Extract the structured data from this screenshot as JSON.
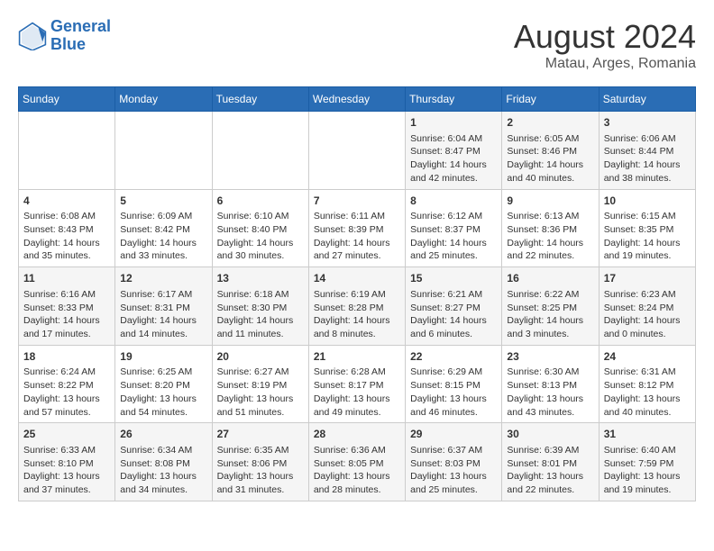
{
  "header": {
    "logo_line1": "General",
    "logo_line2": "Blue",
    "month_year": "August 2024",
    "location": "Matau, Arges, Romania"
  },
  "days_of_week": [
    "Sunday",
    "Monday",
    "Tuesday",
    "Wednesday",
    "Thursday",
    "Friday",
    "Saturday"
  ],
  "weeks": [
    [
      {
        "day": "",
        "content": ""
      },
      {
        "day": "",
        "content": ""
      },
      {
        "day": "",
        "content": ""
      },
      {
        "day": "",
        "content": ""
      },
      {
        "day": "1",
        "content": "Sunrise: 6:04 AM\nSunset: 8:47 PM\nDaylight: 14 hours\nand 42 minutes."
      },
      {
        "day": "2",
        "content": "Sunrise: 6:05 AM\nSunset: 8:46 PM\nDaylight: 14 hours\nand 40 minutes."
      },
      {
        "day": "3",
        "content": "Sunrise: 6:06 AM\nSunset: 8:44 PM\nDaylight: 14 hours\nand 38 minutes."
      }
    ],
    [
      {
        "day": "4",
        "content": "Sunrise: 6:08 AM\nSunset: 8:43 PM\nDaylight: 14 hours\nand 35 minutes."
      },
      {
        "day": "5",
        "content": "Sunrise: 6:09 AM\nSunset: 8:42 PM\nDaylight: 14 hours\nand 33 minutes."
      },
      {
        "day": "6",
        "content": "Sunrise: 6:10 AM\nSunset: 8:40 PM\nDaylight: 14 hours\nand 30 minutes."
      },
      {
        "day": "7",
        "content": "Sunrise: 6:11 AM\nSunset: 8:39 PM\nDaylight: 14 hours\nand 27 minutes."
      },
      {
        "day": "8",
        "content": "Sunrise: 6:12 AM\nSunset: 8:37 PM\nDaylight: 14 hours\nand 25 minutes."
      },
      {
        "day": "9",
        "content": "Sunrise: 6:13 AM\nSunset: 8:36 PM\nDaylight: 14 hours\nand 22 minutes."
      },
      {
        "day": "10",
        "content": "Sunrise: 6:15 AM\nSunset: 8:35 PM\nDaylight: 14 hours\nand 19 minutes."
      }
    ],
    [
      {
        "day": "11",
        "content": "Sunrise: 6:16 AM\nSunset: 8:33 PM\nDaylight: 14 hours\nand 17 minutes."
      },
      {
        "day": "12",
        "content": "Sunrise: 6:17 AM\nSunset: 8:31 PM\nDaylight: 14 hours\nand 14 minutes."
      },
      {
        "day": "13",
        "content": "Sunrise: 6:18 AM\nSunset: 8:30 PM\nDaylight: 14 hours\nand 11 minutes."
      },
      {
        "day": "14",
        "content": "Sunrise: 6:19 AM\nSunset: 8:28 PM\nDaylight: 14 hours\nand 8 minutes."
      },
      {
        "day": "15",
        "content": "Sunrise: 6:21 AM\nSunset: 8:27 PM\nDaylight: 14 hours\nand 6 minutes."
      },
      {
        "day": "16",
        "content": "Sunrise: 6:22 AM\nSunset: 8:25 PM\nDaylight: 14 hours\nand 3 minutes."
      },
      {
        "day": "17",
        "content": "Sunrise: 6:23 AM\nSunset: 8:24 PM\nDaylight: 14 hours\nand 0 minutes."
      }
    ],
    [
      {
        "day": "18",
        "content": "Sunrise: 6:24 AM\nSunset: 8:22 PM\nDaylight: 13 hours\nand 57 minutes."
      },
      {
        "day": "19",
        "content": "Sunrise: 6:25 AM\nSunset: 8:20 PM\nDaylight: 13 hours\nand 54 minutes."
      },
      {
        "day": "20",
        "content": "Sunrise: 6:27 AM\nSunset: 8:19 PM\nDaylight: 13 hours\nand 51 minutes."
      },
      {
        "day": "21",
        "content": "Sunrise: 6:28 AM\nSunset: 8:17 PM\nDaylight: 13 hours\nand 49 minutes."
      },
      {
        "day": "22",
        "content": "Sunrise: 6:29 AM\nSunset: 8:15 PM\nDaylight: 13 hours\nand 46 minutes."
      },
      {
        "day": "23",
        "content": "Sunrise: 6:30 AM\nSunset: 8:13 PM\nDaylight: 13 hours\nand 43 minutes."
      },
      {
        "day": "24",
        "content": "Sunrise: 6:31 AM\nSunset: 8:12 PM\nDaylight: 13 hours\nand 40 minutes."
      }
    ],
    [
      {
        "day": "25",
        "content": "Sunrise: 6:33 AM\nSunset: 8:10 PM\nDaylight: 13 hours\nand 37 minutes."
      },
      {
        "day": "26",
        "content": "Sunrise: 6:34 AM\nSunset: 8:08 PM\nDaylight: 13 hours\nand 34 minutes."
      },
      {
        "day": "27",
        "content": "Sunrise: 6:35 AM\nSunset: 8:06 PM\nDaylight: 13 hours\nand 31 minutes."
      },
      {
        "day": "28",
        "content": "Sunrise: 6:36 AM\nSunset: 8:05 PM\nDaylight: 13 hours\nand 28 minutes."
      },
      {
        "day": "29",
        "content": "Sunrise: 6:37 AM\nSunset: 8:03 PM\nDaylight: 13 hours\nand 25 minutes."
      },
      {
        "day": "30",
        "content": "Sunrise: 6:39 AM\nSunset: 8:01 PM\nDaylight: 13 hours\nand 22 minutes."
      },
      {
        "day": "31",
        "content": "Sunrise: 6:40 AM\nSunset: 7:59 PM\nDaylight: 13 hours\nand 19 minutes."
      }
    ]
  ]
}
